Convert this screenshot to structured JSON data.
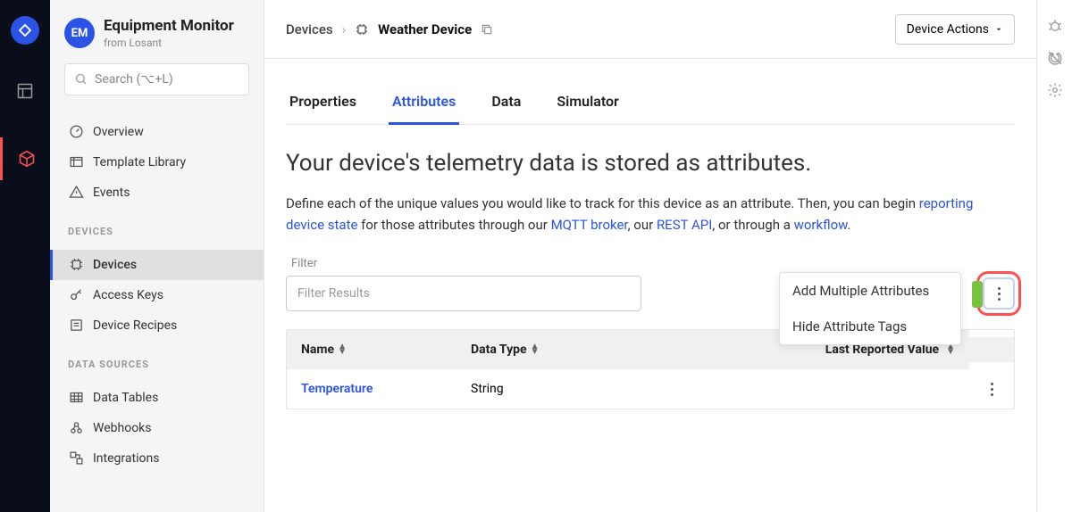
{
  "app": {
    "badge": "EM",
    "title": "Equipment Monitor",
    "subtitle": "from Losant"
  },
  "search": {
    "placeholder": "Search (⌥+L)"
  },
  "sidebar": {
    "items_top": [
      {
        "label": "Overview"
      },
      {
        "label": "Template Library"
      },
      {
        "label": "Events"
      }
    ],
    "heading_devices": "DEVICES",
    "items_devices": [
      {
        "label": "Devices"
      },
      {
        "label": "Access Keys"
      },
      {
        "label": "Device Recipes"
      }
    ],
    "heading_data": "DATA SOURCES",
    "items_data": [
      {
        "label": "Data Tables"
      },
      {
        "label": "Webhooks"
      },
      {
        "label": "Integrations"
      }
    ]
  },
  "breadcrumb": {
    "root": "Devices",
    "current": "Weather Device"
  },
  "actions_btn": "Device Actions",
  "tabs": [
    {
      "label": "Properties"
    },
    {
      "label": "Attributes"
    },
    {
      "label": "Data"
    },
    {
      "label": "Simulator"
    }
  ],
  "page": {
    "heading": "Your device's telemetry data is stored as attributes.",
    "desc_pre": "Define each of the unique values you would like to track for this device as an attribute. Then, you can begin ",
    "link1": "reporting device state",
    "desc_mid1": " for those attributes through our ",
    "link2": "MQTT broker",
    "desc_mid2": ", our ",
    "link3": "REST API",
    "desc_mid3": ", or through a ",
    "link4": "workflow",
    "desc_end": "."
  },
  "filter": {
    "label": "Filter",
    "placeholder": "Filter Results"
  },
  "popup": {
    "item1": "Add Multiple Attributes",
    "item2": "Hide Attribute Tags"
  },
  "table": {
    "col_name": "Name",
    "col_type": "Data Type",
    "col_last": "Last Reported Value",
    "rows": [
      {
        "name": "Temperature",
        "type": "String",
        "last": ""
      }
    ]
  }
}
